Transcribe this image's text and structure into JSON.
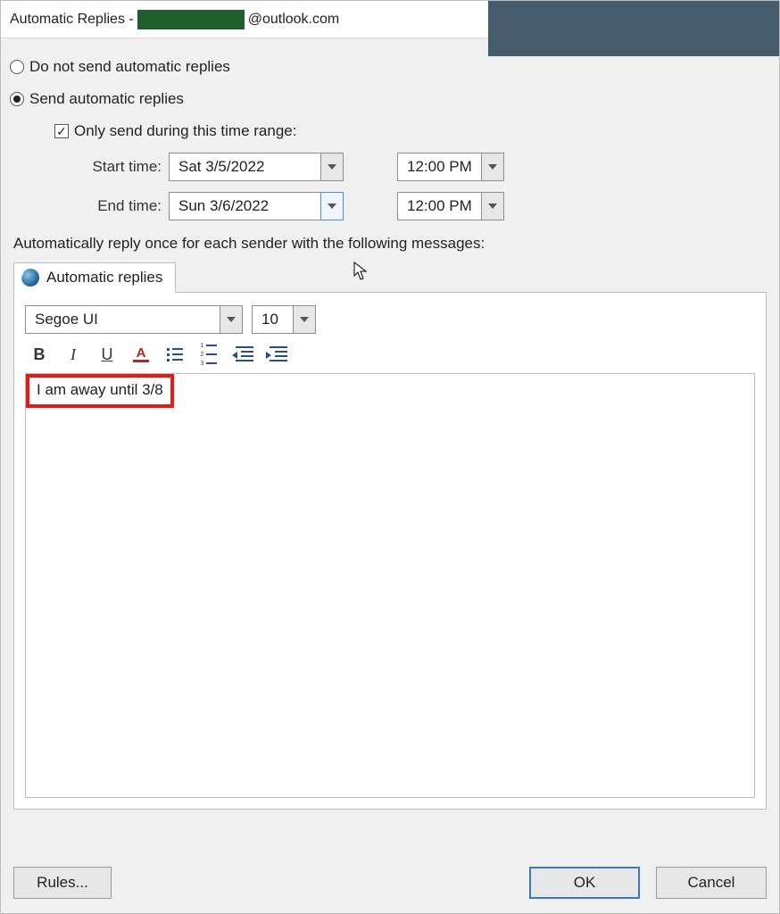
{
  "titlebar": {
    "prefix": "Automatic Replies - ",
    "suffix": "@outlook.com"
  },
  "radios": {
    "do_not_send": "Do not send automatic replies",
    "send": "Send automatic replies"
  },
  "time_range": {
    "checkbox_label": "Only send during this time range:",
    "start_label": "Start time:",
    "end_label": "End time:",
    "start_date": "Sat 3/5/2022",
    "end_date": "Sun 3/6/2022",
    "start_time": "12:00 PM",
    "end_time": "12:00 PM"
  },
  "section_label": "Automatically reply once for each sender with the following messages:",
  "tab": {
    "label": "Automatic replies"
  },
  "editor": {
    "font": "Segoe UI",
    "size": "10",
    "message": "I am away until 3/8"
  },
  "buttons": {
    "rules": "Rules...",
    "ok": "OK",
    "cancel": "Cancel"
  },
  "checkbox_mark": "✓"
}
